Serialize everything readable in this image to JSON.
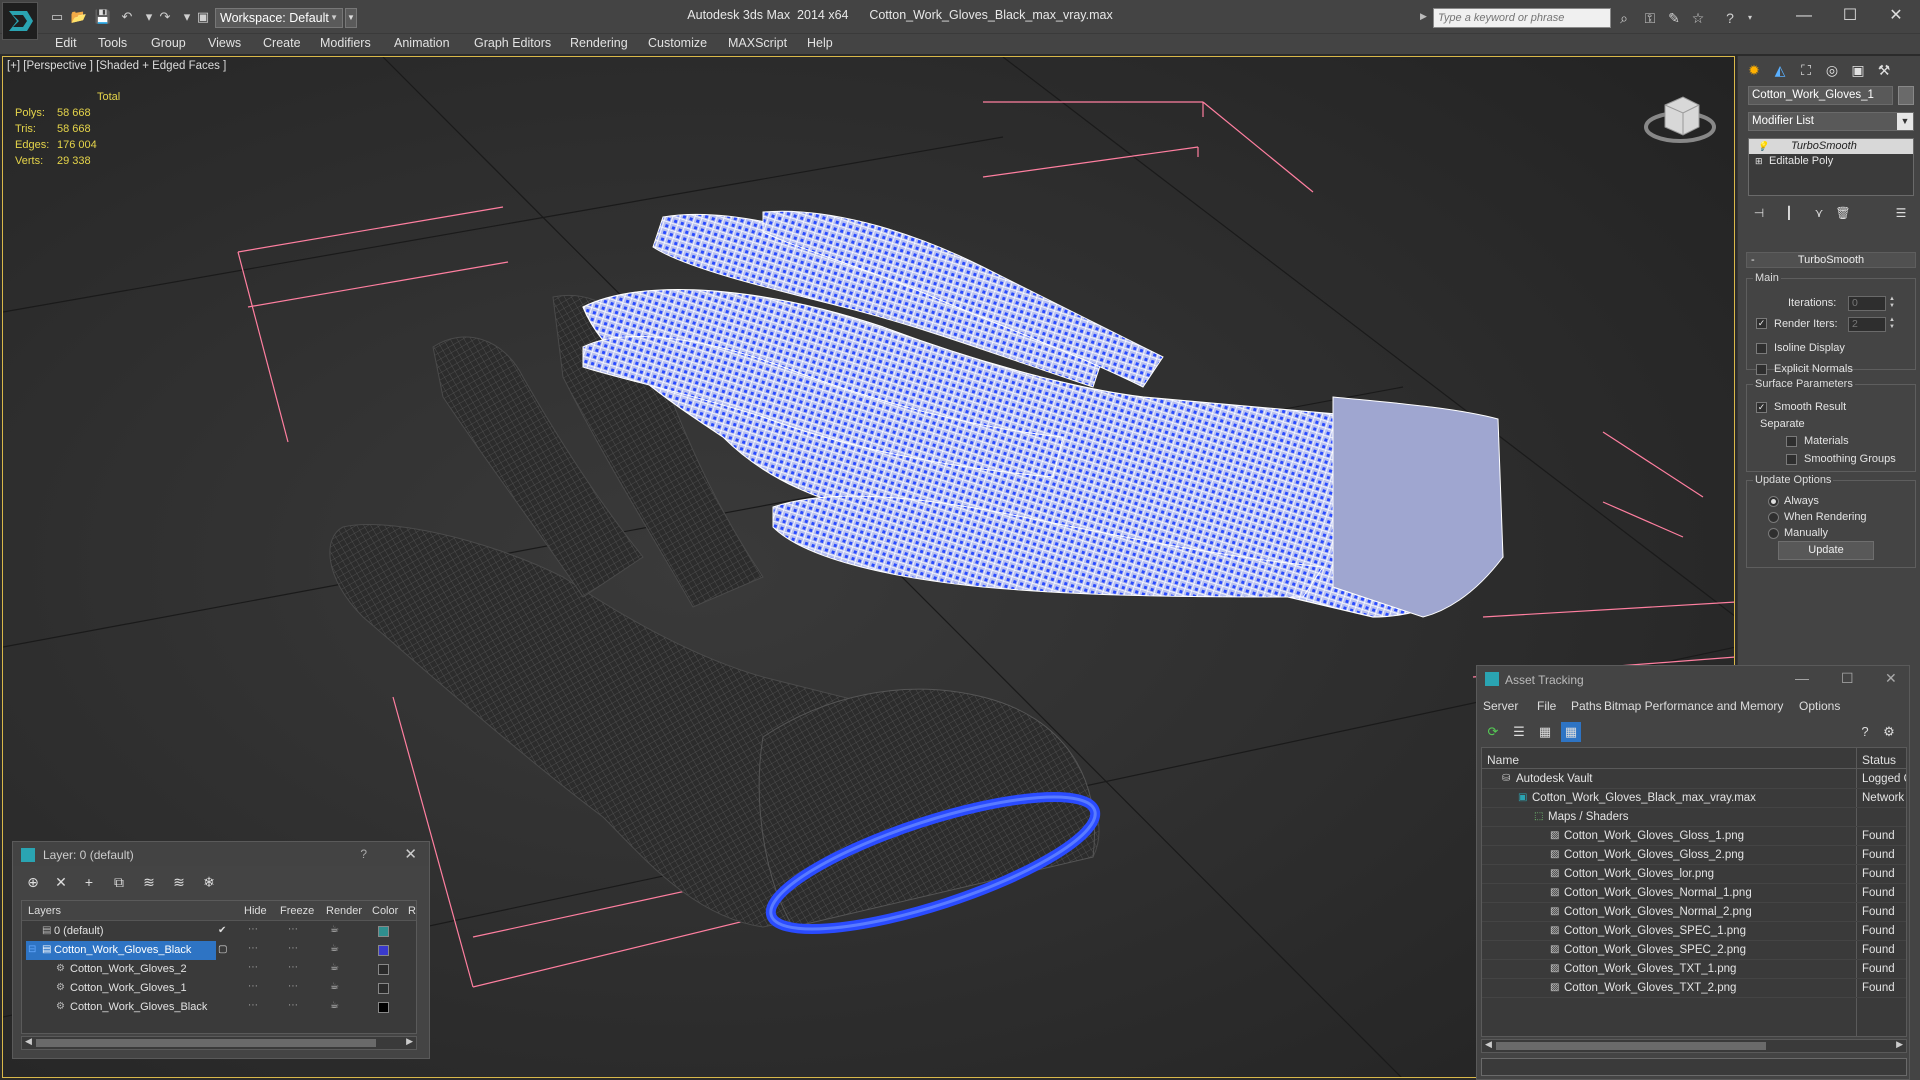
{
  "window": {
    "title": "Autodesk 3ds Max  2014 x64      Cotton_Work_Gloves_Black_max_vray.max",
    "workspace": "Workspace: Default",
    "search_placeholder": "Type a keyword or phrase"
  },
  "menu": [
    "Edit",
    "Tools",
    "Group",
    "Views",
    "Create",
    "Modifiers",
    "Animation",
    "Graph Editors",
    "Rendering",
    "Customize",
    "MAXScript",
    "Help"
  ],
  "viewport": {
    "label": "[+] [Perspective ] [Shaded + Edged Faces ]",
    "stats": {
      "header": "Total",
      "rows": [
        {
          "label": "Polys:",
          "value": "58 668"
        },
        {
          "label": "Tris:",
          "value": "58 668"
        },
        {
          "label": "Edges:",
          "value": "176 004"
        },
        {
          "label": "Verts:",
          "value": "29 338"
        }
      ]
    },
    "colors": {
      "stats": "#e5d44a",
      "border": "#d9b84a",
      "wire_white": "#ffffff",
      "wire_blue": "#2a4bff",
      "gizmo": "#ff7fa0"
    }
  },
  "command_panel": {
    "object_name": "Cotton_Work_Gloves_1",
    "modifier_list": "Modifier List",
    "stack": [
      "TurboSmooth",
      "Editable Poly"
    ],
    "rollout": "TurboSmooth",
    "main_group": "Main",
    "iterations_label": "Iterations:",
    "iterations_value": "0",
    "render_iters_label": "Render Iters:",
    "render_iters_value": "2",
    "isoline_display": "Isoline Display",
    "explicit_normals": "Explicit Normals",
    "surface_params": "Surface Parameters",
    "smooth_result": "Smooth Result",
    "separate": "Separate",
    "materials": "Materials",
    "smoothing_groups": "Smoothing Groups",
    "update_options": "Update Options",
    "always": "Always",
    "when_rendering": "When Rendering",
    "manually": "Manually",
    "update_button": "Update"
  },
  "layer_panel": {
    "title": "Layer: 0 (default)",
    "help": "?",
    "columns": [
      "Layers",
      "Hide",
      "Freeze",
      "Render",
      "Color",
      "R"
    ],
    "rows": [
      {
        "name": "0 (default)",
        "color": "#2f8f8f"
      },
      {
        "name": "Cotton_Work_Gloves_Black",
        "color": "#3a3acc"
      },
      {
        "name": "Cotton_Work_Gloves_2",
        "color": "#2a2a2a"
      },
      {
        "name": "Cotton_Work_Gloves_1",
        "color": "#2a2a2a"
      },
      {
        "name": "Cotton_Work_Gloves_Black",
        "color": "#000000"
      }
    ]
  },
  "asset_tracking": {
    "title": "Asset Tracking",
    "menu": [
      "Server",
      "File",
      "Paths",
      "Bitmap Performance and Memory",
      "Options"
    ],
    "columns": [
      "Name",
      "Status"
    ],
    "rows": [
      {
        "name": "Autodesk Vault",
        "status": "Logged Out"
      },
      {
        "name": "Cotton_Work_Gloves_Black_max_vray.max",
        "status": "Network"
      },
      {
        "name": "Maps / Shaders",
        "status": ""
      },
      {
        "name": "Cotton_Work_Gloves_Gloss_1.png",
        "status": "Found"
      },
      {
        "name": "Cotton_Work_Gloves_Gloss_2.png",
        "status": "Found"
      },
      {
        "name": "Cotton_Work_Gloves_lor.png",
        "status": "Found"
      },
      {
        "name": "Cotton_Work_Gloves_Normal_1.png",
        "status": "Found"
      },
      {
        "name": "Cotton_Work_Gloves_Normal_2.png",
        "status": "Found"
      },
      {
        "name": "Cotton_Work_Gloves_SPEC_1.png",
        "status": "Found"
      },
      {
        "name": "Cotton_Work_Gloves_SPEC_2.png",
        "status": "Found"
      },
      {
        "name": "Cotton_Work_Gloves_TXT_1.png",
        "status": "Found"
      },
      {
        "name": "Cotton_Work_Gloves_TXT_2.png",
        "status": "Found"
      }
    ]
  }
}
